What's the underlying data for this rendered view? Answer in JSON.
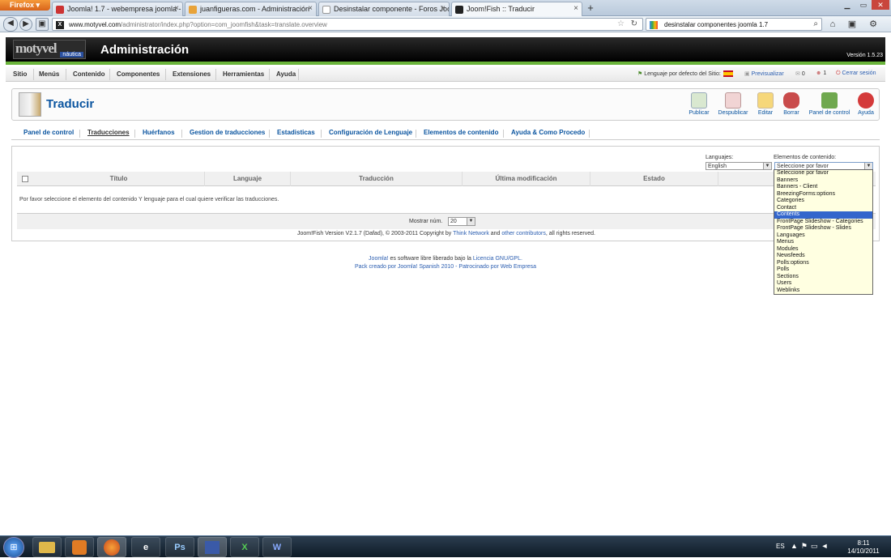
{
  "browser": {
    "app_button": "Firefox",
    "tabs": [
      {
        "label": "Joomla! 1.7 - webempresa joomla - H...",
        "icon": "joomla-tab-icon",
        "active": false
      },
      {
        "label": "juanfigueras.com - Administración",
        "icon": "joomla-tab-icon",
        "active": false
      },
      {
        "label": "Desinstalar componente - Foros Joo...",
        "icon": "page-tab-icon",
        "active": false
      },
      {
        "label": "Joom!Fish :: Traducir",
        "icon": "joomfish-tab-icon",
        "active": true
      }
    ],
    "new_tab": "+",
    "url_domain": "www.motyvel.com",
    "url_path": "/administrator/index.php?option=com_joomfish&task=translate.overview",
    "search_text": "desinstalar componentes joomla 1.7"
  },
  "header": {
    "logo_main": "motyvel",
    "logo_sub": "náutica",
    "title": "Administración",
    "version": "Versión 1.5.23"
  },
  "menu": {
    "items": [
      "Sitio",
      "Menús",
      "Contenido",
      "Componentes",
      "Extensiones",
      "Herramientas",
      "Ayuda"
    ],
    "site_language": "Lenguaje por defecto del Sitio:",
    "preview": "Previsualizar",
    "messages_count": "0",
    "users_count": "1",
    "logout": "Cerrar sesión"
  },
  "toolbar": {
    "page_title": "Traducir",
    "buttons": [
      {
        "label": "Publicar",
        "icon": "publish-icon",
        "color": "#d9e8d0"
      },
      {
        "label": "Despublicar",
        "icon": "unpublish-icon",
        "color": "#f1d4d4"
      },
      {
        "label": "Editar",
        "icon": "edit-icon",
        "color": "#f6d77a"
      },
      {
        "label": "Borrar",
        "icon": "trash-icon",
        "color": "#c94b4b"
      },
      {
        "label": "Panel de control",
        "icon": "control-panel-icon",
        "color": "#6fa84e"
      },
      {
        "label": "Ayuda",
        "icon": "help-icon",
        "color": "#d43a3a"
      }
    ]
  },
  "subnav": {
    "items": [
      {
        "label": "Panel de control",
        "current": false
      },
      {
        "label": "Traducciones",
        "current": true
      },
      {
        "label": "Huérfanos",
        "current": false
      },
      {
        "label": "Gestion de traducciones",
        "current": false
      },
      {
        "label": "Estadisticas",
        "current": false
      },
      {
        "label": "Configuración de Lenguaje",
        "current": false
      },
      {
        "label": "Elementos de contenido",
        "current": false
      },
      {
        "label": "Ayuda & Como Procedo",
        "current": false
      }
    ]
  },
  "filters": {
    "language_label": "Languajes:",
    "language_value": "English",
    "elements_label": "Elementos de contenido:",
    "elements_value": "Seleccione por favor",
    "elements_options": [
      "Seleccione por favor",
      "Banners",
      "Banners - Client",
      "BreezingForms:options",
      "Categories",
      "Contact",
      "Contents",
      "FrontPage Slideshow - Categories",
      "FrontPage Slideshow - Slides",
      "Languages",
      "Menus",
      "Modules",
      "Newsfeeds",
      "Polls:options",
      "Polls",
      "Sections",
      "Users",
      "Weblinks"
    ],
    "elements_highlighted": "Contents"
  },
  "table": {
    "columns": [
      "Título",
      "Languaje",
      "Traducción",
      "Última modificación",
      "Estado"
    ],
    "message": "Por favor seleccione el elemento del contenido Y lenguaje para el cual quiere verificar las traducciones.",
    "show_label": "Mostrar núm.",
    "show_value": "20"
  },
  "copyright": {
    "prefix": "Joom!Fish Version V2.1.7 (Dafad), © 2003-2011 Copyright by",
    "link1": "Think Network",
    "mid": "and",
    "link2": "other contributors",
    "suffix": ", all rights reserved."
  },
  "footer": {
    "link1": "Joomla!",
    "text1": "es software libre liberado bajo la",
    "link2": "Licencia GNU/GPL.",
    "line2": "Pack creado por Joomla! Spanish 2010 - Patrocinado por Web Empresa"
  },
  "taskbar": {
    "items": [
      {
        "label": "",
        "icon": "explorer-icon",
        "color": "#e0b84a"
      },
      {
        "label": "",
        "icon": "media-player-icon",
        "color": "#e07b24"
      },
      {
        "label": "",
        "icon": "firefox-icon",
        "color": "#e25d1f"
      },
      {
        "label": "",
        "icon": "internet-explorer-icon",
        "color": "#2d7fd6"
      },
      {
        "label": "Ps",
        "icon": "photoshop-icon",
        "color": "#1b3a6b"
      },
      {
        "label": "",
        "icon": "network-tool-icon",
        "color": "#3a5aa8"
      },
      {
        "label": "X",
        "icon": "excel-icon",
        "color": "#1e7145"
      },
      {
        "label": "W",
        "icon": "word-icon",
        "color": "#2b579a"
      }
    ],
    "lang": "ES",
    "time": "8:11",
    "date": "14/10/2011"
  }
}
